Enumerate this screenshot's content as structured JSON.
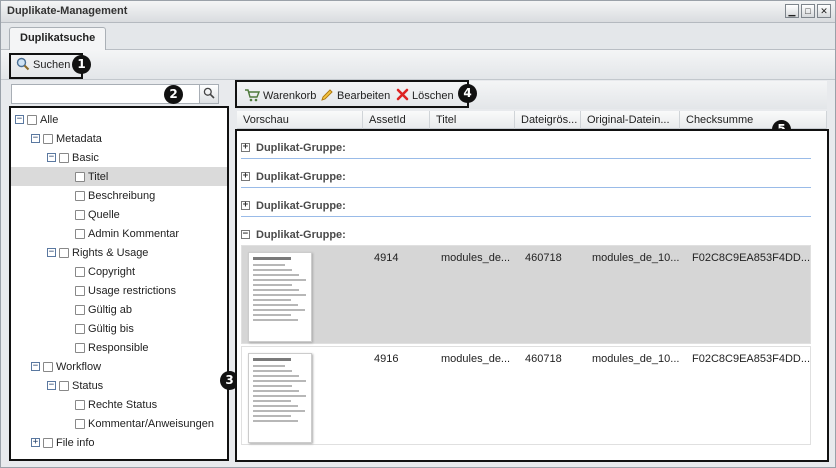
{
  "window": {
    "title": "Duplikate-Management",
    "controls": [
      "▁",
      "□",
      "✕"
    ]
  },
  "tabs": [
    {
      "label": "Duplikatsuche"
    }
  ],
  "toolbar": {
    "search_label": "Suchen"
  },
  "markers": [
    "1",
    "2",
    "3",
    "4",
    "5"
  ],
  "filter": {
    "search_value": "",
    "tree": [
      {
        "label": "Alle",
        "expander": "−",
        "level": 0
      },
      {
        "label": "Metadata",
        "expander": "−",
        "level": 1
      },
      {
        "label": "Basic",
        "expander": "−",
        "level": 2
      },
      {
        "label": "Titel",
        "expander": "",
        "level": 3,
        "selected": true
      },
      {
        "label": "Beschreibung",
        "expander": "",
        "level": 3
      },
      {
        "label": "Quelle",
        "expander": "",
        "level": 3
      },
      {
        "label": "Admin Kommentar",
        "expander": "",
        "level": 3
      },
      {
        "label": "Rights & Usage",
        "expander": "−",
        "level": 2
      },
      {
        "label": "Copyright",
        "expander": "",
        "level": 3
      },
      {
        "label": "Usage restrictions",
        "expander": "",
        "level": 3
      },
      {
        "label": "Gültig ab",
        "expander": "",
        "level": 3
      },
      {
        "label": "Gültig bis",
        "expander": "",
        "level": 3
      },
      {
        "label": "Responsible",
        "expander": "",
        "level": 3
      },
      {
        "label": "Workflow",
        "expander": "−",
        "level": 1
      },
      {
        "label": "Status",
        "expander": "−",
        "level": 2
      },
      {
        "label": "Rechte Status",
        "expander": "",
        "level": 3
      },
      {
        "label": "Kommentar/Anweisungen",
        "expander": "",
        "level": 3
      },
      {
        "label": "File info",
        "expander": "+",
        "level": 1
      }
    ]
  },
  "results_toolbar": {
    "cart_label": "Warenkorb",
    "edit_label": "Bearbeiten",
    "delete_label": "Löschen"
  },
  "grid": {
    "columns": [
      "Vorschau",
      "AssetId",
      "Titel",
      "Dateigrös...",
      "Original-Datein...",
      "Checksumme"
    ],
    "groups": [
      {
        "label": "Duplikat-Gruppe:",
        "expander": "+"
      },
      {
        "label": "Duplikat-Gruppe:",
        "expander": "+"
      },
      {
        "label": "Duplikat-Gruppe:",
        "expander": "+"
      },
      {
        "label": "Duplikat-Gruppe:",
        "expander": "−"
      }
    ],
    "rows": [
      {
        "asset_id": "4914",
        "title": "modules_de...",
        "size": "460718",
        "original": "modules_de_10...",
        "checksum": "F02C8C9EA853F4DD...",
        "selected": true
      },
      {
        "asset_id": "4916",
        "title": "modules_de...",
        "size": "460718",
        "original": "modules_de_10...",
        "checksum": "F02C8C9EA853F4DD...",
        "selected": false
      }
    ]
  }
}
